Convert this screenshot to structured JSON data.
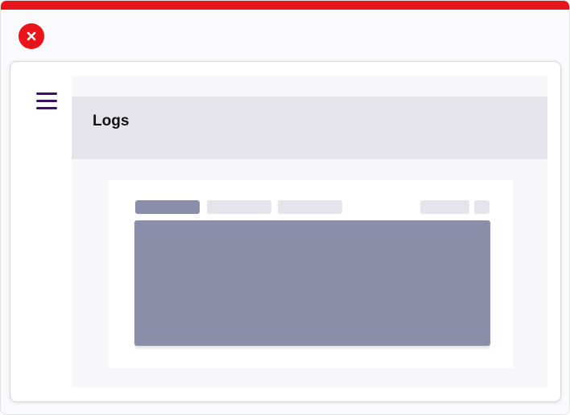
{
  "window": {
    "accent_color": "#e8141a",
    "close_icon": "close-icon"
  },
  "sidebar": {
    "menu_icon": "hamburger-menu-icon",
    "menu_color": "#3e0f63"
  },
  "header": {
    "title": "Logs"
  },
  "skeleton": {
    "placeholder_color": "#e4e4ea",
    "active_color": "#8a8ea8"
  }
}
